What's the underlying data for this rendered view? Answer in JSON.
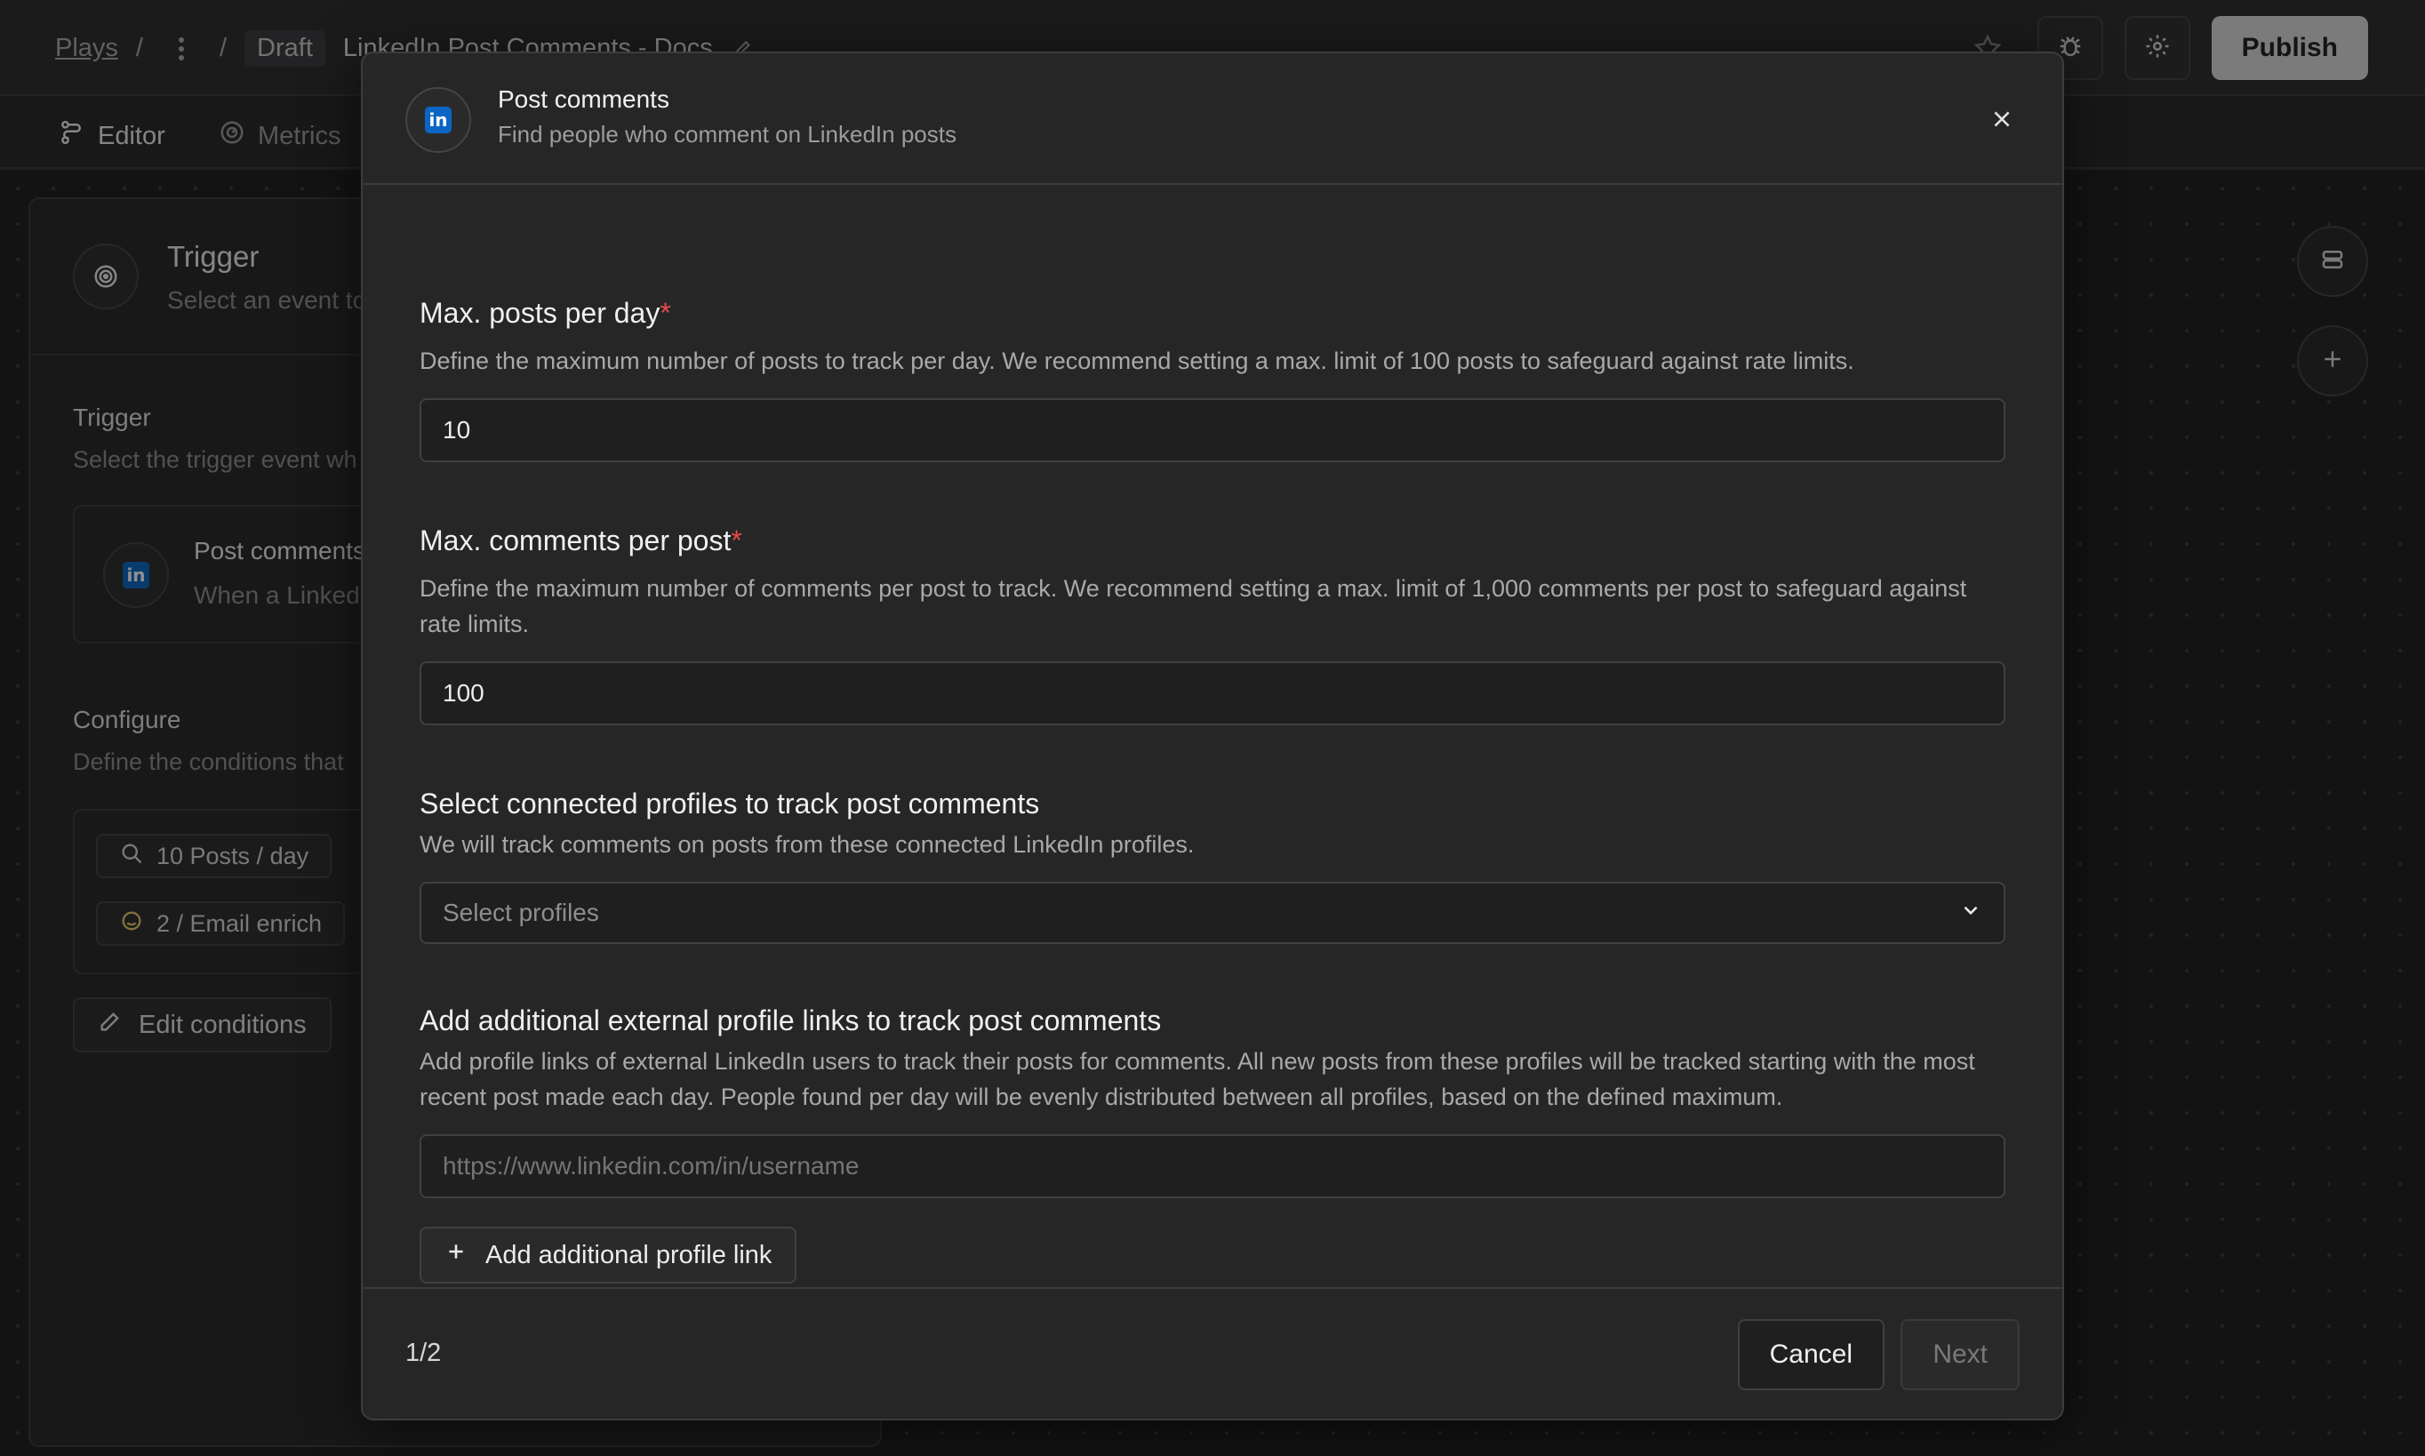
{
  "breadcrumb": {
    "plays": "Plays",
    "sep1": "/",
    "sep2": "/",
    "draft": "Draft",
    "title": "LinkedIn Post Comments - Docs"
  },
  "header": {
    "publish_label": "Publish"
  },
  "tabs": [
    {
      "label": "Editor",
      "icon": "flow-icon",
      "active": true
    },
    {
      "label": "Metrics",
      "icon": "gauge-icon",
      "active": false
    }
  ],
  "panel": {
    "title": "Trigger",
    "subtitle": "Select an event to",
    "trigger_label": "Trigger",
    "trigger_sub": "Select the trigger event wh",
    "card_title": "Post comments",
    "card_sub": "When a Linked",
    "configure_label": "Configure",
    "configure_sub": "Define the conditions that",
    "chips": [
      "10 Posts / day",
      "2 / Email enrich"
    ],
    "edit_label": "Edit conditions"
  },
  "modal": {
    "title": "Post comments",
    "subtitle": "Find people who comment on LinkedIn posts",
    "fields": {
      "max_posts": {
        "label": "Max. posts per day",
        "required": "*",
        "description": "Define the maximum number of posts to track per day. We recommend setting a max. limit of 100 posts to safeguard against rate limits.",
        "value": "10"
      },
      "max_comments": {
        "label": "Max. comments per post",
        "required": "*",
        "description": "Define the maximum number of comments per post to track. We recommend setting a max. limit of 1,000 comments per post to safeguard against rate limits.",
        "value": "100"
      },
      "profiles": {
        "label": "Select connected profiles to track post comments",
        "description": "We will track comments on posts from these connected LinkedIn profiles.",
        "placeholder": "Select profiles"
      },
      "external": {
        "label": "Add additional external profile links to track post comments",
        "description": "Add profile links of external LinkedIn users to track their posts for comments. All new posts from these profiles will be tracked starting with the most recent post made each day. People found per day will be evenly distributed between all profiles, based on the defined maximum.",
        "placeholder": "https://www.linkedin.com/in/username",
        "add_label": "Add additional profile link"
      }
    },
    "footer": {
      "step": "1/2",
      "cancel_label": "Cancel",
      "next_label": "Next"
    }
  },
  "brand": {
    "linkedin_color": "#0a66c2",
    "required_color": "#e5484d"
  },
  "linkedin_glyph": "in"
}
